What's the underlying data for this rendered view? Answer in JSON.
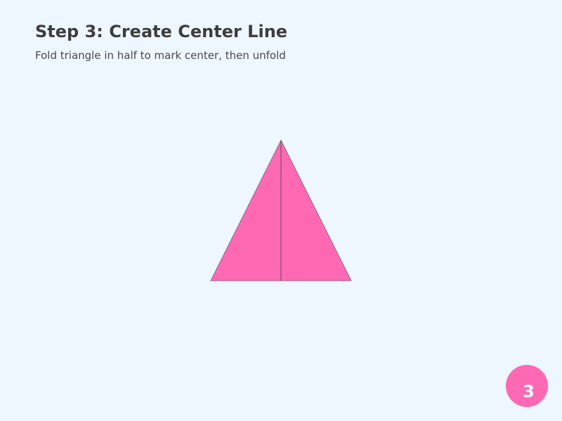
{
  "header": {
    "title": "Step 3: Create Center Line",
    "subtitle": "Fold triangle in half to mark center, then unfold"
  },
  "diagram": {
    "paper_color": "#ff69b4",
    "outline_color": "#8a6a86",
    "crease_color": "#5a4a5a"
  },
  "badge": {
    "step_number": "3",
    "color": "#ff69b4"
  }
}
